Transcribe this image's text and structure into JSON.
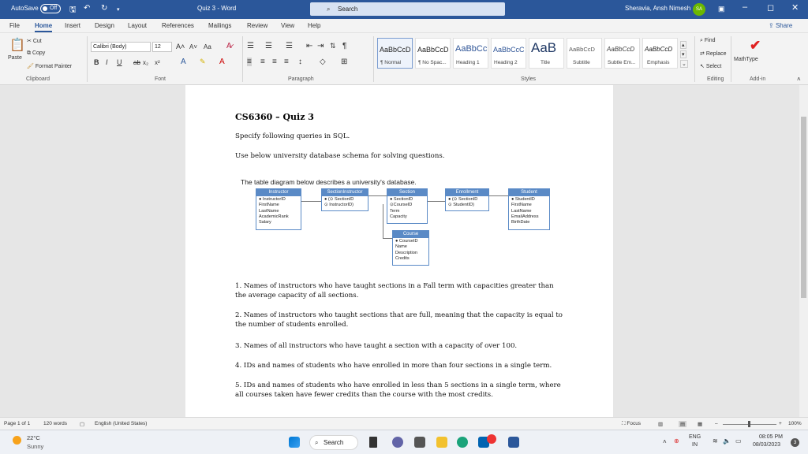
{
  "titlebar": {
    "autosave_label": "AutoSave",
    "autosave_state": "Off",
    "doc_title": "Quiz 3 - Word",
    "search_label": "Search",
    "user_name": "Sheravia, Ansh Nimesh",
    "user_initials": "SA",
    "qa_save_icon": "save-icon",
    "qa_undo_icon": "undo-icon",
    "qa_redo_icon": "redo-icon"
  },
  "menubar": {
    "items": [
      "File",
      "Home",
      "Insert",
      "Design",
      "Layout",
      "References",
      "Mailings",
      "Review",
      "View",
      "Help"
    ],
    "active": "Home",
    "share_label": "Share"
  },
  "ribbon": {
    "clipboard": {
      "paste": "Paste",
      "cut": "Cut",
      "copy": "Copy",
      "format_painter": "Format Painter",
      "group": "Clipboard"
    },
    "font": {
      "name": "Calibri (Body)",
      "size": "12",
      "group": "Font",
      "aa": "Aa"
    },
    "paragraph": {
      "group": "Paragraph"
    },
    "styles": {
      "group": "Styles",
      "items": [
        {
          "sample": "AaBbCcD",
          "name": "¶ Normal"
        },
        {
          "sample": "AaBbCcD",
          "name": "¶ No Spac..."
        },
        {
          "sample": "AaBbCc",
          "name": "Heading 1"
        },
        {
          "sample": "AaBbCcC",
          "name": "Heading 2"
        },
        {
          "sample": "AaB",
          "name": "Title"
        },
        {
          "sample": "AaBbCcD",
          "name": "Subtitle"
        },
        {
          "sample": "AaBbCcD",
          "name": "Subtle Em..."
        },
        {
          "sample": "AaBbCcD",
          "name": "Emphasis"
        }
      ]
    },
    "editing": {
      "find": "Find",
      "replace": "Replace",
      "select": "Select",
      "group": "Editing"
    },
    "addin": {
      "mathtype": "MathType",
      "group": "Add-in"
    }
  },
  "document": {
    "title": "CS6360 – Quiz 3",
    "intro1": "Specify following queries in SQL.",
    "intro2": "Use below university database schema for solving questions.",
    "diagram": {
      "caption": "The table diagram below describes a university's database.",
      "tables": [
        {
          "name": "Instructor",
          "fields": [
            "● InstructorID",
            "FirstName",
            "LastName",
            "AcademicRank",
            "Salary"
          ]
        },
        {
          "name": "SectionInstructor",
          "fields": [
            "● (⊙ SectionID",
            "⊙ InstructorID)"
          ]
        },
        {
          "name": "Section",
          "fields": [
            "● SectionID",
            "⊙CourseID",
            "Term",
            "Capacity"
          ]
        },
        {
          "name": "Enrollment",
          "fields": [
            "● (⊙ SectionID",
            "⊙ StudentID)"
          ]
        },
        {
          "name": "Student",
          "fields": [
            "● StudentID",
            "FirstName",
            "LastName",
            "EmailAddress",
            "BirthDate"
          ]
        },
        {
          "name": "Course",
          "fields": [
            "● CourseID",
            "Name",
            "Description",
            "Credits"
          ]
        }
      ]
    },
    "questions": [
      "1. Names of instructors who have taught sections in a Fall term with capacities greater than the average capacity of all sections.",
      "2. Names of instructors who taught sections that are full, meaning that the capacity is equal to the number of students enrolled.",
      "3. Names of all instructors who have taught a section with a capacity of over 100.",
      "4. IDs and names of students who have enrolled in more than four sections in a single term.",
      "5. IDs and names of students who have enrolled in less than 5 sections in a single term, where all courses taken have fewer credits than the course with the most credits."
    ]
  },
  "statusbar": {
    "page": "Page 1 of 1",
    "words": "120 words",
    "language": "English (United States)",
    "focus": "Focus",
    "zoom": "100%"
  },
  "taskbar": {
    "temp": "22°C",
    "weather": "Sunny",
    "search_label": "Search",
    "lang1": "ENG",
    "lang2": "IN",
    "time": "08:05 PM",
    "date": "08/03/2023",
    "notif_count": "3"
  }
}
